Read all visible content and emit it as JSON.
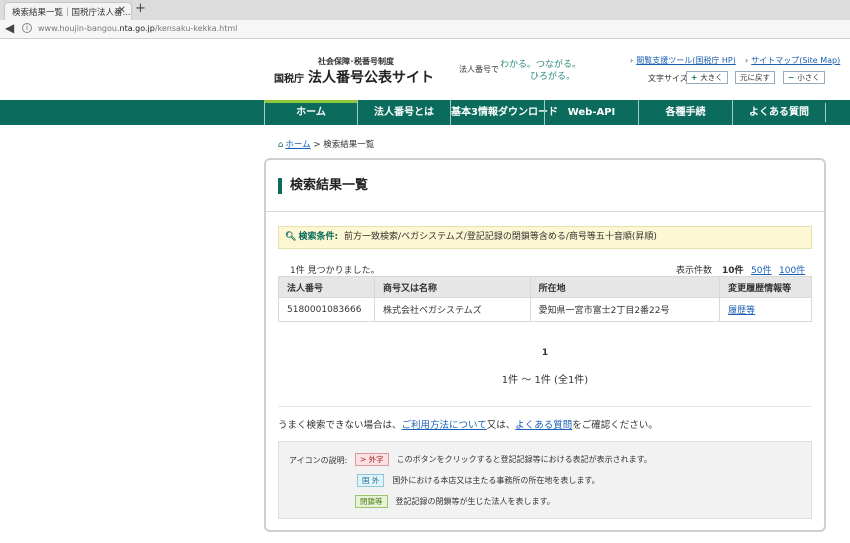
{
  "browser": {
    "tab_title": "検索結果一覧｜国税庁法人番...",
    "url_prefix": "www.houjin-bangou.",
    "url_domain": "nta.go.jp",
    "url_path": "/kensaku-kekka.html"
  },
  "header": {
    "logo_small": "社会保障･税番号制度",
    "logo_agency": "国税庁",
    "logo_title": "法人番号公表サイト",
    "tagline": "法人番号で",
    "tagline_art_1": "わかる。つながる。",
    "tagline_art_2": "ひろがる。",
    "link_support": "閲覧支援ツール(国税庁 HP)",
    "link_sitemap": "サイトマップ(Site Map)",
    "font_size_label": "文字サイズ",
    "font_bigger": "大きく",
    "font_reset": "元に戻す",
    "font_smaller": "小さく"
  },
  "nav": [
    "ホーム",
    "法人番号とは",
    "基本3情報ダウンロード",
    "Web-API",
    "各種手続",
    "よくある質問"
  ],
  "breadcrumb": {
    "home": "ホーム",
    "separator": ">",
    "current": "検索結果一覧"
  },
  "panel": {
    "title": "検索結果一覧",
    "condition_label": "検索条件:",
    "condition_text": "前方一致検索/ベガシステムズ/登記記録の閉鎖等含める/商号等五十音順(昇順)",
    "found_text": "1件 見つかりました。",
    "per_page_label": "表示件数",
    "per_page_current": "10件",
    "per_page_50": "50件",
    "per_page_100": "100件",
    "columns": [
      "法人番号",
      "商号又は名称",
      "所在地",
      "変更履歴情報等"
    ],
    "rows": [
      {
        "number": "5180001083666",
        "name": "株式会社ベガシステムズ",
        "address": "愛知県一宮市富士2丁目2番22号",
        "history": "履歴等"
      }
    ],
    "page_number": "1",
    "page_range": "1件 〜 1件 (全1件)",
    "help_prefix": "うまく検索できない場合は、",
    "help_link1": "ご利用方法について",
    "help_mid": "又は、",
    "help_link2": "よくある質問",
    "help_suffix": "をご確認ください。"
  },
  "legend": {
    "title": "アイコンの説明:",
    "items": [
      {
        "badge": "> 外字",
        "text": "このボタンをクリックすると登記記録等における表記が表示されます。"
      },
      {
        "badge": "国 外",
        "text": "国外における本店又は主たる事務所の所在地を表します。"
      },
      {
        "badge": "閉鎖等",
        "text": "登記記録の閉鎖等が生じた法人を表します。"
      }
    ]
  },
  "colors": {
    "brand": "#0b6b5c",
    "nav_active": "#8fc93a",
    "condition_bg": "#fdf7d3"
  }
}
